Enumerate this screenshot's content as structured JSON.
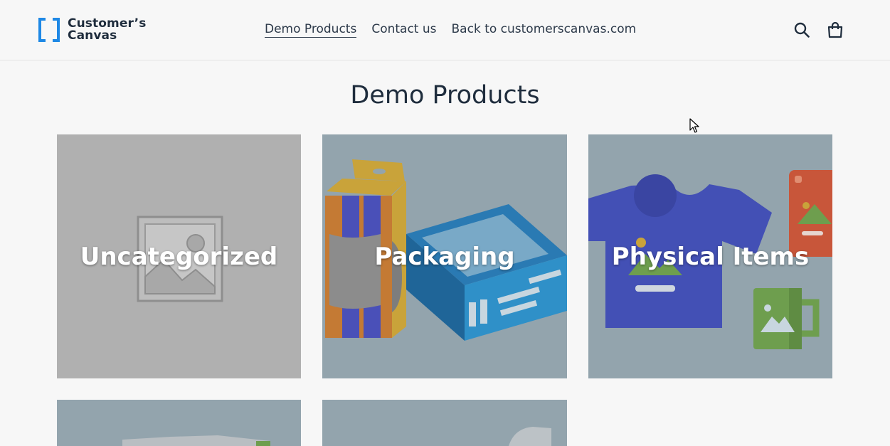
{
  "brand": {
    "line1": "Customer’s",
    "line2": "Canvas"
  },
  "nav": {
    "items": [
      {
        "label": "Demo Products",
        "active": true
      },
      {
        "label": "Contact us",
        "active": false
      },
      {
        "label": "Back to customerscanvas.com",
        "active": false
      }
    ]
  },
  "header_icons": [
    "search-icon",
    "cart-icon"
  ],
  "page": {
    "title": "Demo Products"
  },
  "collections": [
    {
      "label": "Uncategorized",
      "image": "placeholder-image-icon"
    },
    {
      "label": "Packaging",
      "image": "packaging-illustration"
    },
    {
      "label": "Physical Items",
      "image": "physical-items-illustration"
    },
    {
      "label": "",
      "image": "collection-4-illustration"
    },
    {
      "label": "",
      "image": "collection-5-illustration"
    }
  ],
  "colors": {
    "brand_blue": "#1e88e5",
    "card_overlay": "#93a4ad",
    "placeholder_gray": "#b0b0b0"
  }
}
